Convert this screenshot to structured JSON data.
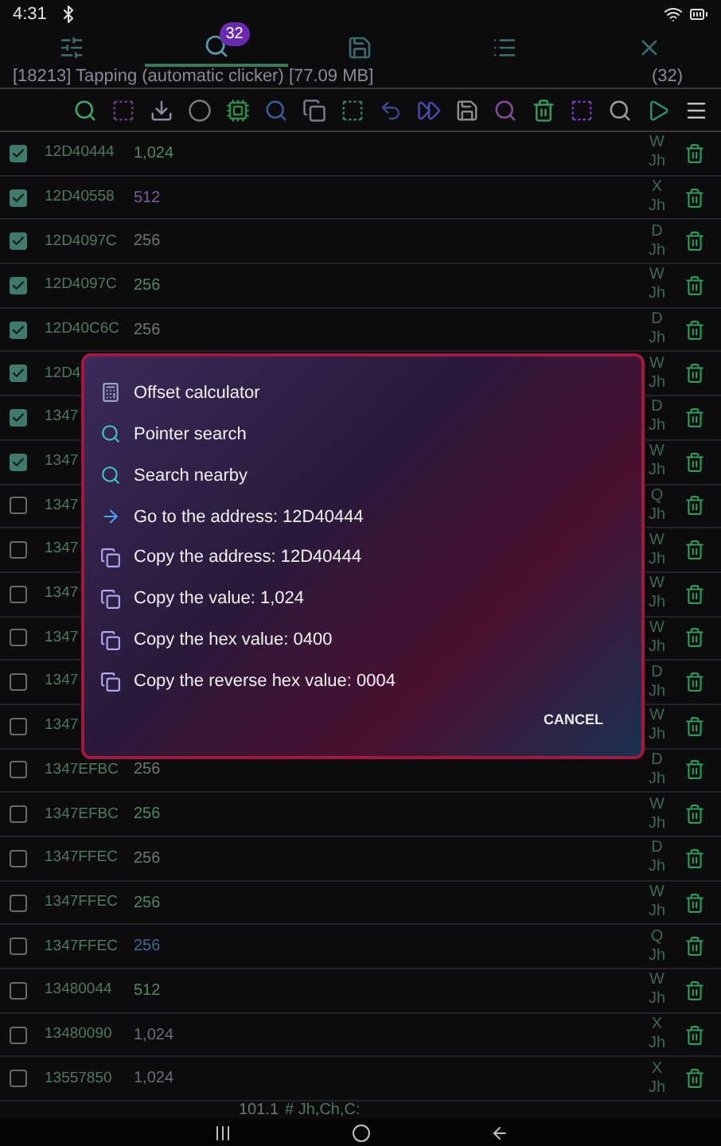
{
  "status_bar": {
    "time": "4:31"
  },
  "tabs": [
    {
      "kind": "settings",
      "selected": false
    },
    {
      "kind": "search",
      "selected": true,
      "badge": "32"
    },
    {
      "kind": "save",
      "selected": false
    },
    {
      "kind": "list",
      "selected": false
    },
    {
      "kind": "close",
      "selected": false
    }
  ],
  "process": {
    "label": "[18213] Tapping (automatic clicker) [77.09 MB]",
    "count": "(32)"
  },
  "rows": [
    {
      "checked": true,
      "address": "12D40444",
      "value": "1,024",
      "color": "#4f8a5c",
      "type": "W",
      "flags": "Jh"
    },
    {
      "checked": true,
      "address": "12D40558",
      "value": "512",
      "color": "#7a5a9a",
      "type": "X",
      "flags": "Jh"
    },
    {
      "checked": true,
      "address": "12D4097C",
      "value": "256",
      "color": "#6b7b6b",
      "type": "D",
      "flags": "Jh"
    },
    {
      "checked": true,
      "address": "12D4097C",
      "value": "256",
      "color": "#4f8a5c",
      "type": "W",
      "flags": "Jh"
    },
    {
      "checked": true,
      "address": "12D40C6C",
      "value": "256",
      "color": "#6b7b6b",
      "type": "D",
      "flags": "Jh"
    },
    {
      "checked": true,
      "address": "12D4",
      "type": "W",
      "flags": "Jh"
    },
    {
      "checked": true,
      "address": "1347",
      "type": "D",
      "flags": "Jh"
    },
    {
      "checked": true,
      "address": "1347",
      "type": "W",
      "flags": "Jh"
    },
    {
      "checked": false,
      "address": "1347",
      "type": "Q",
      "flags": "Jh"
    },
    {
      "checked": false,
      "address": "1347",
      "type": "W",
      "flags": "Jh"
    },
    {
      "checked": false,
      "address": "1347",
      "type": "W",
      "flags": "Jh"
    },
    {
      "checked": false,
      "address": "1347",
      "type": "W",
      "flags": "Jh"
    },
    {
      "checked": false,
      "address": "1347",
      "type": "D",
      "flags": "Jh"
    },
    {
      "checked": false,
      "address": "1347",
      "type": "W",
      "flags": "Jh"
    },
    {
      "checked": false,
      "address": "1347EFBC",
      "value": "256",
      "color": "#6b7b6b",
      "type": "D",
      "flags": "Jh"
    },
    {
      "checked": false,
      "address": "1347EFBC",
      "value": "256",
      "color": "#4f8a5c",
      "type": "W",
      "flags": "Jh"
    },
    {
      "checked": false,
      "address": "1347FFEC",
      "value": "256",
      "color": "#6b7b6b",
      "type": "D",
      "flags": "Jh"
    },
    {
      "checked": false,
      "address": "1347FFEC",
      "value": "256",
      "color": "#4f8a5c",
      "type": "W",
      "flags": "Jh"
    },
    {
      "checked": false,
      "address": "1347FFEC",
      "value": "256",
      "color": "#3f6a8a",
      "type": "Q",
      "flags": "Jh"
    },
    {
      "checked": false,
      "address": "13480044",
      "value": "512",
      "color": "#4f8a5c",
      "type": "W",
      "flags": "Jh"
    },
    {
      "checked": false,
      "address": "13480090",
      "value": "1,024",
      "color": "#6b6b7b",
      "type": "X",
      "flags": "Jh"
    },
    {
      "checked": false,
      "address": "13557850",
      "value": "1,024",
      "color": "#6b6b7b",
      "type": "X",
      "flags": "Jh"
    }
  ],
  "footer": {
    "version": "101.1",
    "filter": "# Jh,Ch,C:"
  },
  "dialog": {
    "items": [
      {
        "kind": "calculator",
        "label": "Offset calculator"
      },
      {
        "kind": "pointer",
        "label": "Pointer search"
      },
      {
        "kind": "nearby",
        "label": "Search nearby"
      },
      {
        "kind": "goto",
        "label": "Go to the address: 12D40444"
      },
      {
        "kind": "copy",
        "label": "Copy the address: 12D40444"
      },
      {
        "kind": "copy",
        "label": "Copy the value: 1,024"
      },
      {
        "kind": "copy",
        "label": "Copy the hex value: 0400"
      },
      {
        "kind": "copy",
        "label": "Copy the reverse hex value: 0004"
      }
    ],
    "cancel": "CANCEL"
  }
}
